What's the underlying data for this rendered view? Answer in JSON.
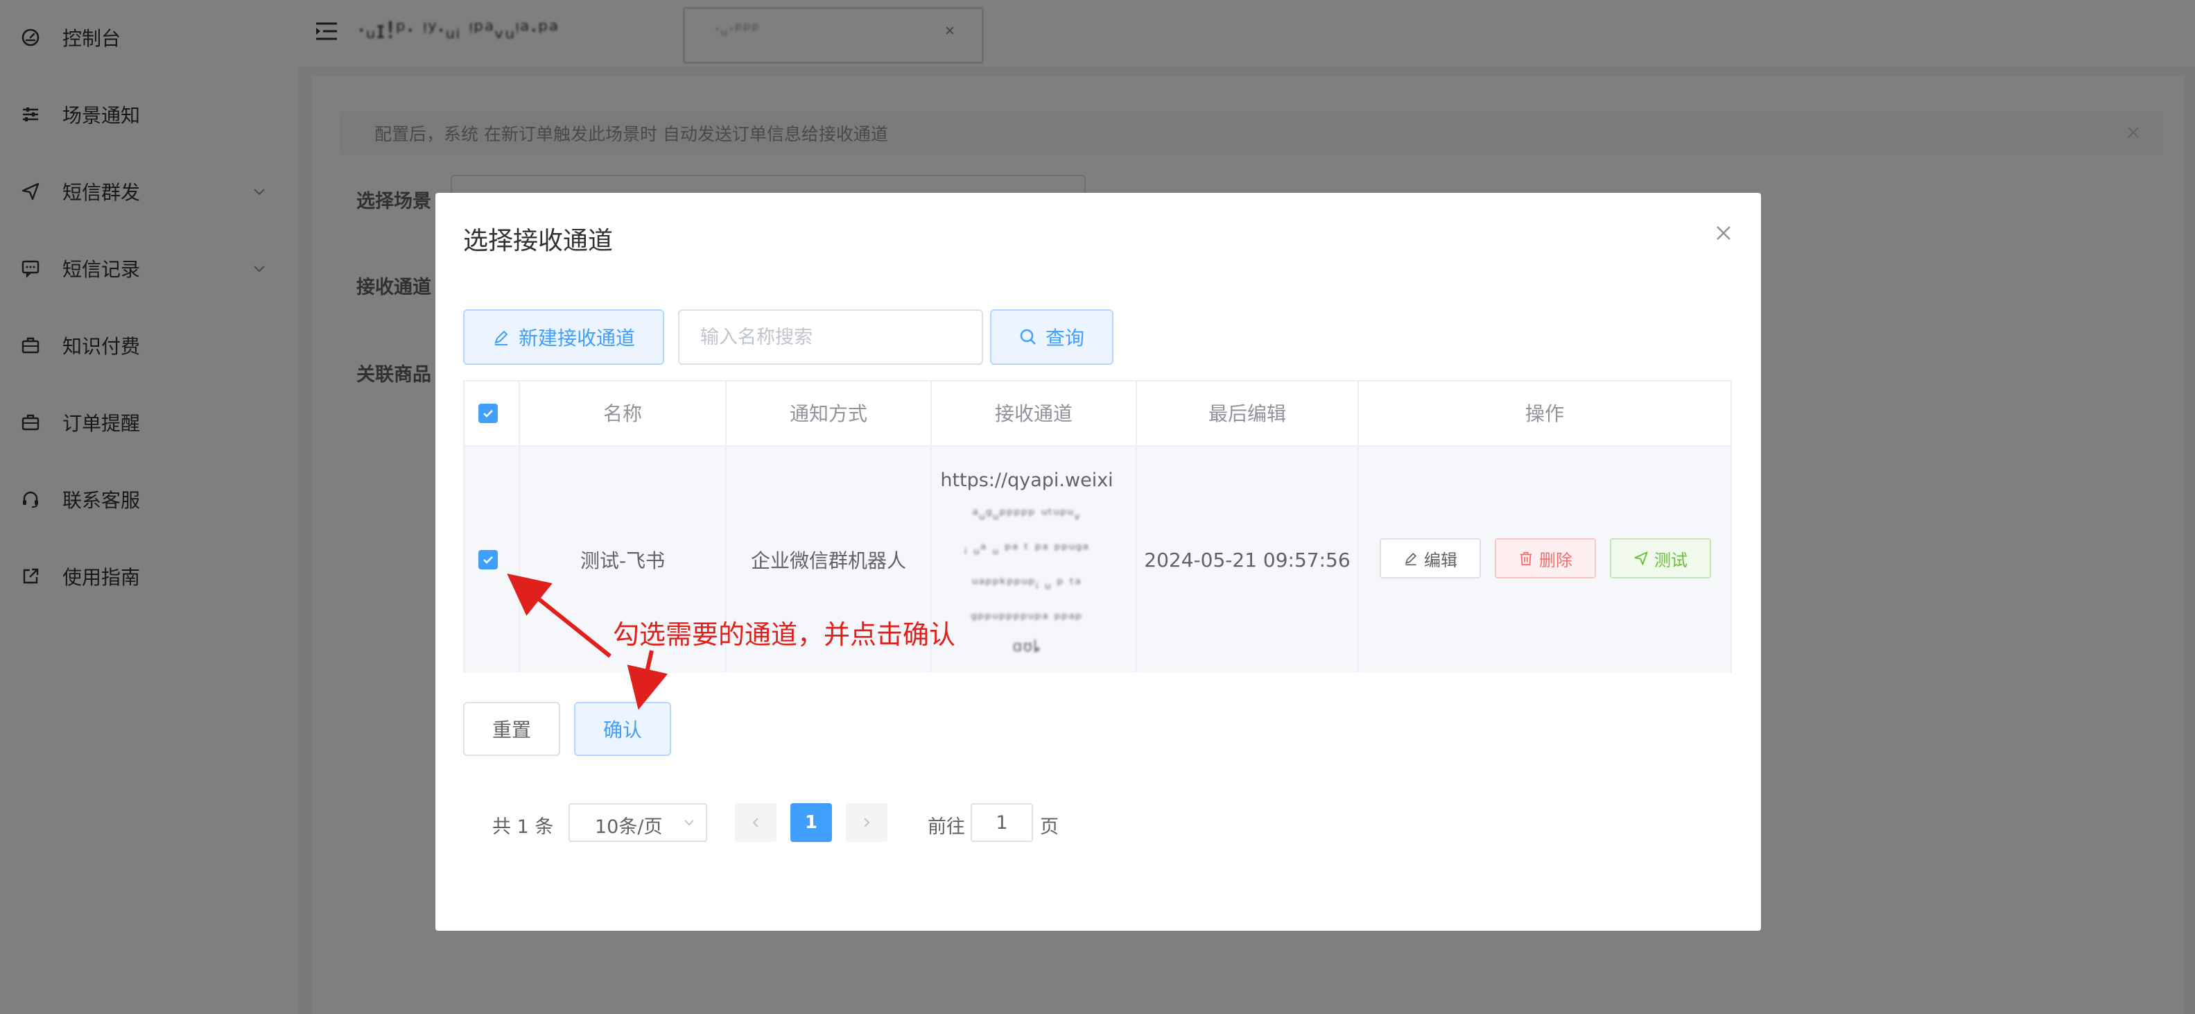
{
  "sidebar": {
    "items": [
      {
        "label": "控制台",
        "icon": "dashboard-icon"
      },
      {
        "label": "场景通知",
        "icon": "sliders-icon"
      },
      {
        "label": "短信群发",
        "icon": "send-icon",
        "has_arrow": true
      },
      {
        "label": "短信记录",
        "icon": "message-icon",
        "has_arrow": true
      },
      {
        "label": "知识付费",
        "icon": "briefcase-icon"
      },
      {
        "label": "订单提醒",
        "icon": "briefcase-icon"
      },
      {
        "label": "联系客服",
        "icon": "headset-icon"
      },
      {
        "label": "使用指南",
        "icon": "external-link-icon"
      }
    ]
  },
  "header": {
    "title_blurred": "·ᵤɪ!ᵖ· ᵎʸ·ᵤᵢ ᵎᵖᵃᵥᵤᵎᵃ·ᵖᵃ",
    "tab_blurred": "·ᵤ·ᵖᵖᵖ"
  },
  "main": {
    "alert_text": "配置后，系统 在新订单触发此场景时 自动发送订单信息给接收通道",
    "labels": {
      "scene": "选择场景",
      "channel": "接收通道",
      "product": "关联商品"
    }
  },
  "dialog": {
    "title": "选择接收通道",
    "new_button": "新建接收通道",
    "search_placeholder": "输入名称搜索",
    "search_value": "",
    "query_button": "查询",
    "table": {
      "headers": [
        "名称",
        "通知方式",
        "接收通道",
        "最后编辑",
        "操作"
      ],
      "rows": [
        {
          "name": "测试-飞书",
          "method": "企业微信群机器人",
          "url_first": "https://qyapi.weixi",
          "url_blurred": [
            "ᵃᵤᵍᵤᵖᵖᵖᵖᵖ ᵘᵗᵘᵖᵘᵥ",
            "ᵢ ᵤᵃ ᵤ ᵖᵃ ᵗ ᵖᵃ ᵖᵖᵘᵍᵃ",
            "ᵘᵃᵖᵖᵏᵖᵖᵘᵖᵢ ᵤ ᵖ ᵗᵃ",
            "ᵍᵖᵖᵘᵖᵖᵖᵖᵘᵖᵃ ᵖᵖᵃᵖ"
          ],
          "url_last": "ɑʊȴ",
          "updated": "2024-05-21 09:57:56",
          "ops": {
            "edit": "编辑",
            "delete": "删除",
            "test": "测试"
          }
        }
      ]
    },
    "reset_button": "重置",
    "confirm_button": "确认",
    "pagination": {
      "total": "共 1 条",
      "page_size": "10条/页",
      "current_page": "1",
      "goto_label": "前往",
      "goto_value": "1",
      "page_unit": "页"
    }
  },
  "annotation": {
    "text": "勾选需要的通道，并点击确认",
    "color": "#e0201c"
  }
}
